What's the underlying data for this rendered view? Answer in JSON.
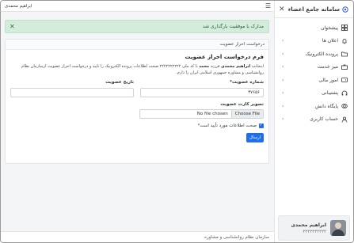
{
  "sidebar": {
    "title": "سامانه جامع اعضاء",
    "items": [
      {
        "label": "پیشخوان",
        "icon": "grid-icon",
        "chevron": false
      },
      {
        "label": "اعلان ها",
        "icon": "bell-icon",
        "chevron": true
      },
      {
        "label": "پرونده الکترونیک",
        "icon": "folder-icon",
        "chevron": true
      },
      {
        "label": "میز خدمت",
        "icon": "desk-icon",
        "chevron": true
      },
      {
        "label": "امور مالی",
        "icon": "wallet-icon",
        "chevron": true
      },
      {
        "label": "پشتیبانی",
        "icon": "headset-icon",
        "chevron": true
      },
      {
        "label": "پایگاه دانش",
        "icon": "brain-icon",
        "chevron": true
      },
      {
        "label": "حساب کاربری",
        "icon": "user-icon",
        "chevron": true
      }
    ],
    "user": {
      "name": "ابراهیم محمدی",
      "code": "۲۲۲۲۲۲۲۲۲۲"
    }
  },
  "topbar": {
    "user_name": "ابراهیم محمدی"
  },
  "alert": {
    "text": "مدارک با موفقیت بارگذاری شد"
  },
  "card": {
    "header": "درخواست احراز عضویت",
    "form_title": "فرم درخواست احراز عضویت",
    "intro_part1": "اینجانب",
    "intro_name": "ابراهیم محمدی",
    "intro_part2": "فرزند",
    "intro_father": "محمد",
    "intro_part3": "با کد ملی ۲۲۲۲۲۲۲۲۲۲ صحت اطلاعات پرونده الکترونیک را تایید و درخواست احراز عضویت ازسازمان نظام",
    "intro_line2": "روانشناسی و مشاوره جمهوری اسلامی ایران را دارم.",
    "membership_label": "شماره عضویت*",
    "membership_value": "۳۷۶۵۶",
    "date_label": "تاریخ عضویت",
    "date_value": "",
    "file_label": "تصویر کارت عضویت",
    "file_button": "Choose File",
    "file_text": "No file chosen",
    "confirm_label": "صحت اطلاعات مورد تأیید است*",
    "submit_label": "ارسال"
  },
  "footer": {
    "text": "سازمان نظام روانشناسی و مشاوره"
  },
  "colors": {
    "primary": "#1f6feb",
    "alert_bg": "#d4ecdc",
    "alert_text": "#1e5a32"
  }
}
